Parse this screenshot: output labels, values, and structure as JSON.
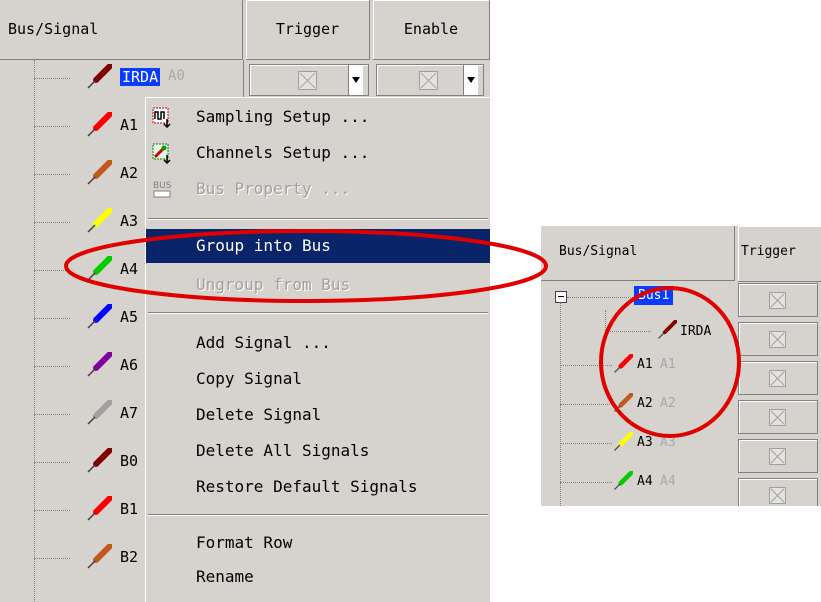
{
  "left_panel": {
    "header": {
      "bus_signal": "Bus/Signal",
      "trigger": "Trigger",
      "enable": "Enable"
    },
    "signals": [
      {
        "name": "IRDA",
        "alias": "A0",
        "color": "#800000",
        "selected": true
      },
      {
        "name": "A1",
        "color": "#ff0000"
      },
      {
        "name": "A2",
        "color": "#c05820"
      },
      {
        "name": "A3",
        "color": "#ffff00"
      },
      {
        "name": "A4",
        "color": "#00cc00"
      },
      {
        "name": "A5",
        "color": "#0000ff"
      },
      {
        "name": "A6",
        "color": "#8000a0"
      },
      {
        "name": "A7",
        "color": "#a0a0a0"
      },
      {
        "name": "B0",
        "color": "#800000"
      },
      {
        "name": "B1",
        "color": "#ff0000"
      },
      {
        "name": "B2",
        "color": "#c05820"
      }
    ]
  },
  "context_menu": {
    "items": [
      {
        "label": "Sampling Setup ...",
        "icon": "sampling-setup-icon"
      },
      {
        "label": "Channels Setup ...",
        "icon": "channels-setup-icon"
      },
      {
        "label": "Bus Property ...",
        "icon": "bus-icon",
        "icon_text": "BUS",
        "disabled": true
      },
      {
        "label": "Group into Bus",
        "highlighted": true
      },
      {
        "label": "Ungroup from Bus",
        "disabled": true
      },
      {
        "label": "Add Signal ..."
      },
      {
        "label": "Copy Signal"
      },
      {
        "label": "Delete Signal"
      },
      {
        "label": "Delete All Signals"
      },
      {
        "label": "Restore Default Signals"
      },
      {
        "label": "Format Row"
      },
      {
        "label": "Rename"
      }
    ]
  },
  "right_panel": {
    "header": {
      "bus_signal": "Bus/Signal",
      "trigger": "Trigger"
    },
    "bus": {
      "name": "Bus1"
    },
    "bus_child": {
      "name": "IRDA",
      "color": "#800000"
    },
    "signals": [
      {
        "name": "A1",
        "alias": "A1",
        "color": "#ff0000"
      },
      {
        "name": "A2",
        "alias": "A2",
        "color": "#c05820"
      },
      {
        "name": "A3",
        "alias": "A3",
        "color": "#ffff00"
      },
      {
        "name": "A4",
        "alias": "A4",
        "color": "#00cc00"
      }
    ]
  },
  "annotation_color": "#e00000"
}
